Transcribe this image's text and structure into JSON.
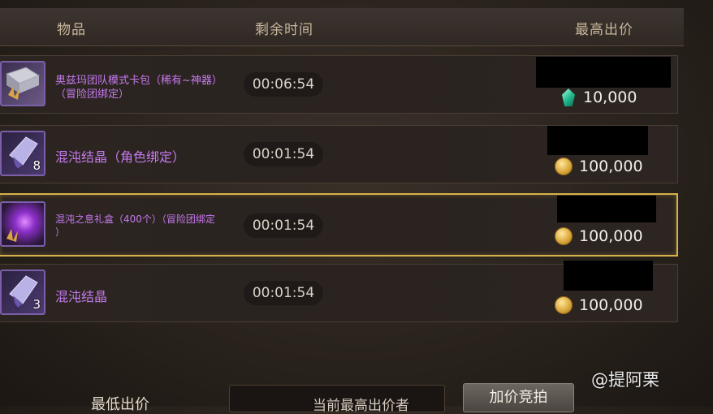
{
  "header": {
    "col_item": "物品",
    "col_time": "剩余时间",
    "col_price": "最高出价"
  },
  "rows": [
    {
      "name_line1": "奥兹玛团队模式卡包（稀有~神器）",
      "name_line2": "（冒险团绑定）",
      "time": "00:06:54",
      "price": "10,000",
      "currency_icon": "gem-icon",
      "quantity": "",
      "selected": false
    },
    {
      "name_line1": "混沌结晶（角色绑定）",
      "name_line2": "",
      "time": "00:01:54",
      "price": "100,000",
      "currency_icon": "gold-coin-icon",
      "quantity": "8",
      "selected": false
    },
    {
      "name_line1": "混沌之息礼盒（400个）（冒险团绑定",
      "name_line2": "）",
      "time": "00:01:54",
      "price": "100,000",
      "currency_icon": "gold-coin-icon",
      "quantity": "",
      "selected": true
    },
    {
      "name_line1": "混沌结晶",
      "name_line2": "",
      "time": "00:01:54",
      "price": "100,000",
      "currency_icon": "gold-coin-icon",
      "quantity": "3",
      "selected": false
    }
  ],
  "footer": {
    "min_bid_label": "最低出价",
    "current_bidder_label": "当前最高出价者",
    "raise_button": "加价竞拍"
  },
  "watermark": "@提阿栗",
  "colors": {
    "item_name": "#c679ef",
    "selected_border": "#d7b24a",
    "header_text": "#c9b79c"
  }
}
